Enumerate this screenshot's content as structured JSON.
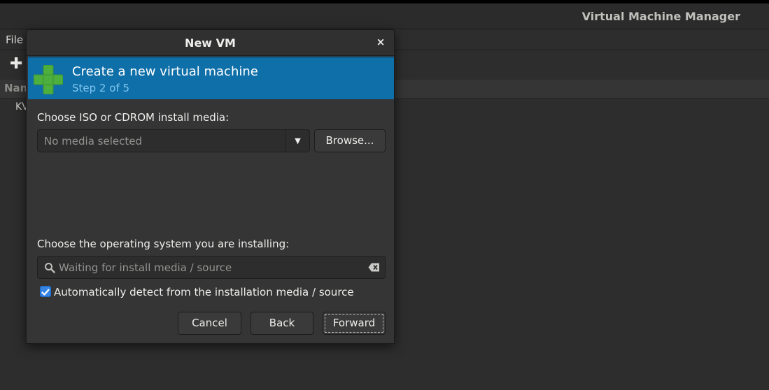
{
  "main_window": {
    "title": "Virtual Machine Manager",
    "menu_file": "File",
    "list_header_name": "Nan",
    "list_row_first": "KV"
  },
  "dialog": {
    "title": "New VM",
    "close_glyph": "×",
    "banner": {
      "title": "Create a new virtual machine",
      "step": "Step 2 of 5",
      "icon": "green-plus-icon"
    },
    "media_label": "Choose ISO or CDROM install media:",
    "media_combo_value": "No media selected",
    "browse_label": "Browse...",
    "os_label": "Choose the operating system you are installing:",
    "os_search_placeholder": "Waiting for install media / source",
    "autodetect_label": "Automatically detect from the installation media / source",
    "autodetect_checked": true,
    "buttons": {
      "cancel": "Cancel",
      "back": "Back",
      "forward": "Forward"
    }
  },
  "colors": {
    "banner_bg": "#0f6fa8",
    "banner_step": "#7fc6ef",
    "checkbox_accent": "#3584e4",
    "plus_green": "#4caf3e"
  }
}
